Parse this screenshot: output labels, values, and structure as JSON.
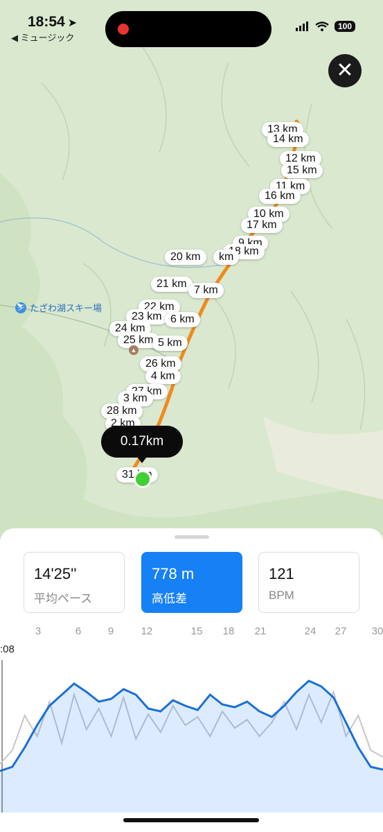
{
  "status": {
    "time": "18:54",
    "back": "◀ ミュージック",
    "battery": "100"
  },
  "map": {
    "place": "たざわ湖スキー場",
    "tooltip": "0.17km",
    "km_labels": [
      "13 km",
      "14 km",
      "12 km",
      "15 km",
      "11 km",
      "16 km",
      "10 km",
      "17 km",
      "9 km",
      "18 km",
      "20 km",
      "km",
      "21 km",
      "7 km",
      "22 km",
      "23 km",
      "6 km",
      "24 km",
      "25 km",
      "5 km",
      "26 km",
      "4 km",
      "27 km",
      "3 km",
      "28 km",
      "2 km",
      "31 km"
    ]
  },
  "stats": [
    {
      "value": "14'25''",
      "label": "平均ペース",
      "active": false
    },
    {
      "value": "778 m",
      "label": "高低差",
      "active": true
    },
    {
      "value": "121",
      "label": "BPM",
      "active": false
    }
  ],
  "axis": {
    "ticks": [
      "3",
      "6",
      "9",
      "12",
      "15",
      "18",
      "21",
      "24",
      "27",
      "30"
    ],
    "y_label": ":08"
  },
  "colors": {
    "accent": "#1680f5",
    "route": "#f08a1c",
    "elevation_line": "#1b6fd6",
    "hr_line": "#c7c7c7"
  },
  "chart_data": {
    "type": "line",
    "x": [
      0,
      1,
      2,
      3,
      4,
      5,
      6,
      7,
      8,
      9,
      10,
      11,
      12,
      13,
      14,
      15,
      16,
      17,
      18,
      19,
      20,
      21,
      22,
      23,
      24,
      25,
      26,
      27,
      28,
      29,
      30,
      31
    ],
    "series": [
      {
        "values": [
          5,
          8,
          22,
          38,
          52,
          60,
          68,
          62,
          55,
          57,
          64,
          60,
          50,
          48,
          56,
          52,
          49,
          60,
          53,
          51,
          55,
          48,
          44,
          52,
          62,
          70,
          66,
          58,
          40,
          22,
          8,
          6
        ]
      },
      {
        "values": [
          10,
          20,
          45,
          30,
          55,
          25,
          60,
          35,
          50,
          30,
          58,
          28,
          46,
          33,
          52,
          38,
          44,
          30,
          48,
          36,
          42,
          30,
          40,
          55,
          35,
          60,
          40,
          62,
          30,
          45,
          20,
          15
        ]
      }
    ]
  }
}
